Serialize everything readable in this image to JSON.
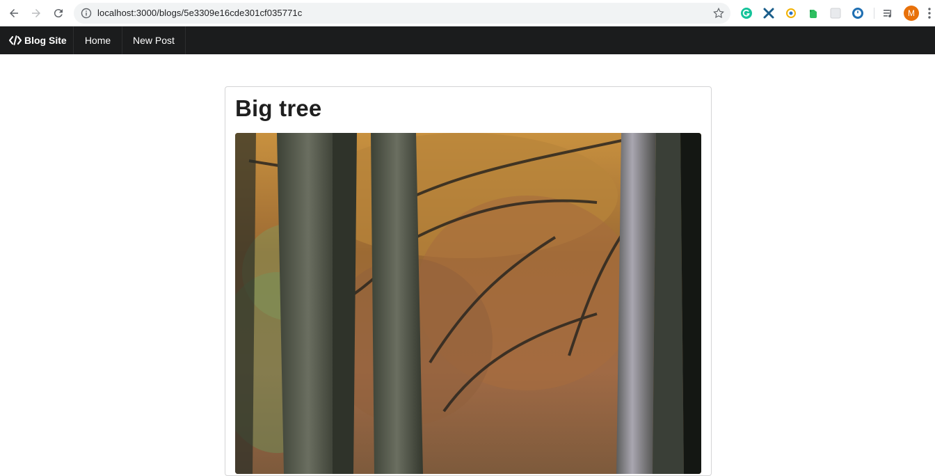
{
  "browser": {
    "url": "localhost:3000/blogs/5e3309e16cde301cf035771c",
    "profile_initial": "M"
  },
  "navbar": {
    "brand": "Blog Site",
    "items": [
      {
        "label": "Home"
      },
      {
        "label": "New Post"
      }
    ]
  },
  "post": {
    "title": "Big tree",
    "image_alt": "autumn forest trees"
  }
}
